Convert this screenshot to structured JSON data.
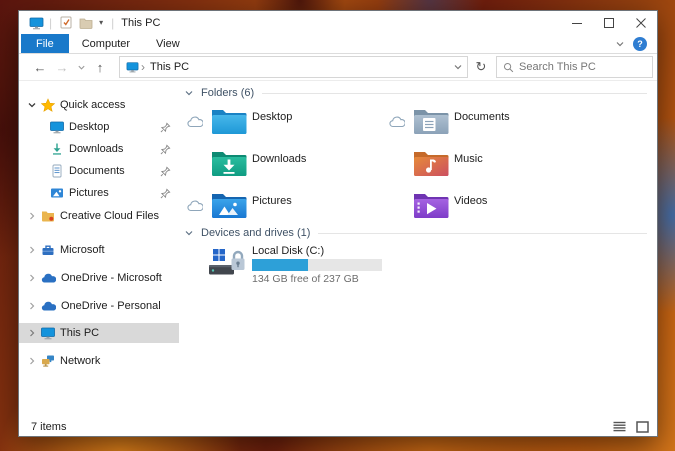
{
  "window": {
    "title": "This PC"
  },
  "glyphs": {
    "back": "←",
    "forward": "→",
    "up": "↑",
    "refresh": "↻",
    "breadcrumb_sep": "›",
    "toolbar_dropdown": "▾",
    "titlebar_sep": "|"
  },
  "ribbon": {
    "tabs": [
      {
        "label": "File",
        "active": true
      },
      {
        "label": "Computer",
        "active": false
      },
      {
        "label": "View",
        "active": false
      }
    ],
    "help_glyph": "?"
  },
  "navbar": {
    "breadcrumb_root": "This PC",
    "search_placeholder": "Search This PC"
  },
  "sidebar": {
    "quick_access": {
      "label": "Quick access",
      "items": [
        {
          "label": "Desktop",
          "icon": "desktop",
          "pinned": true
        },
        {
          "label": "Downloads",
          "icon": "downloads",
          "pinned": true
        },
        {
          "label": "Documents",
          "icon": "documents",
          "pinned": true
        },
        {
          "label": "Pictures",
          "icon": "pictures",
          "pinned": true
        }
      ]
    },
    "roots": [
      {
        "label": "Creative Cloud Files",
        "icon": "creative-cloud-folder"
      },
      {
        "label": "Microsoft",
        "icon": "briefcase"
      },
      {
        "label": "OneDrive - Microsoft",
        "icon": "onedrive-cloud"
      },
      {
        "label": "OneDrive - Personal",
        "icon": "onedrive-cloud"
      },
      {
        "label": "This PC",
        "icon": "computer",
        "selected": true
      },
      {
        "label": "Network",
        "icon": "network"
      }
    ]
  },
  "content": {
    "folders": {
      "header": "Folders (6)",
      "tiles": [
        {
          "label": "Desktop",
          "cloud": true
        },
        {
          "label": "Documents",
          "cloud": true
        },
        {
          "label": "Downloads",
          "cloud": false
        },
        {
          "label": "Music",
          "cloud": false
        },
        {
          "label": "Pictures",
          "cloud": true
        },
        {
          "label": "Videos",
          "cloud": false
        }
      ]
    },
    "devices": {
      "header": "Devices and drives (1)",
      "drive": {
        "label": "Local Disk (C:)",
        "free_text": "134 GB free of 237 GB",
        "used_percent": 43,
        "fill_style": "width:43%"
      }
    }
  },
  "statusbar": {
    "items_count": "7 items"
  },
  "colors": {
    "accent_tab": "#1979ca",
    "selection": "#d9d9d9",
    "progress_fill": "#2da0d8",
    "progress_track": "#e6e6e6",
    "folder_desktop": "#2ba3dc",
    "folder_documents": "#96abc0",
    "folder_downloads": "#1aa98e",
    "folder_music": "#d96b4a",
    "folder_pictures": "#2b8ede",
    "folder_videos": "#8e4fd0",
    "onedrive_blue": "#2a70c2",
    "help_blue": "#2f7dd1"
  }
}
